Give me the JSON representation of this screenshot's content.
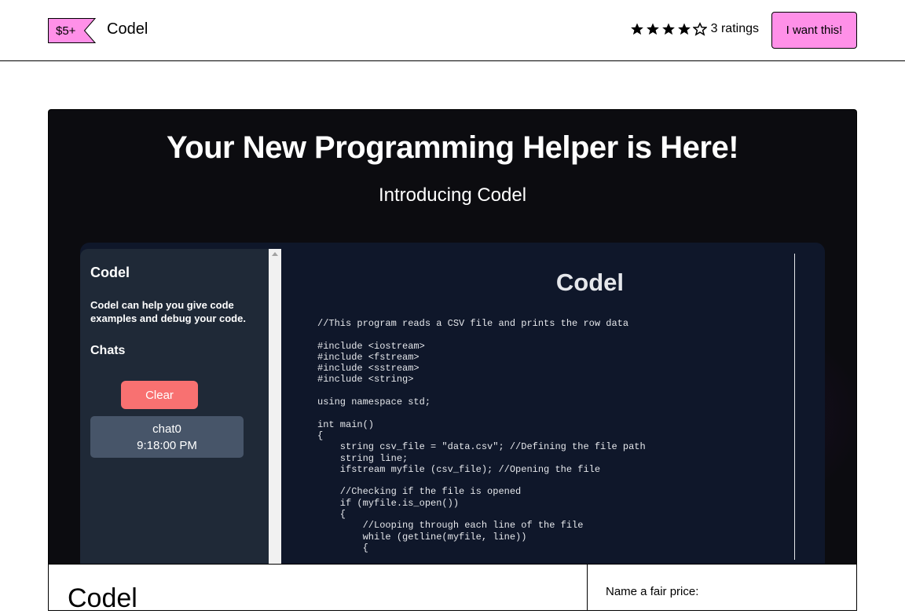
{
  "header": {
    "price": "$5+",
    "product_name": "Codel",
    "rating_filled": 4,
    "rating_max": 5,
    "ratings_text": "3 ratings",
    "want_button": "I want this!",
    "accent_color": "#ff90e8"
  },
  "hero": {
    "title": "Your New Programming Helper is Here!",
    "subtitle": "Introducing Codel"
  },
  "app_mock": {
    "sidebar": {
      "title": "Codel",
      "description": "Codel can help you give code examples and debug your code.",
      "chats_heading": "Chats",
      "clear_button": "Clear",
      "chat_item": {
        "name": "chat0",
        "time": "9:18:00 PM"
      }
    },
    "main": {
      "title": "Codel",
      "code": "//This program reads a CSV file and prints the row data\n\n#include <iostream>\n#include <fstream>\n#include <sstream>\n#include <string>\n\nusing namespace std;\n\nint main()\n{\n    string csv_file = \"data.csv\"; //Defining the file path\n    string line;\n    ifstream myfile (csv_file); //Opening the file\n\n    //Checking if the file is opened\n    if (myfile.is_open())\n    {\n        //Looping through each line of the file\n        while (getline(myfile, line))\n        {"
    }
  },
  "details": {
    "product_title": "Codel",
    "price_label": "Name a fair price:"
  }
}
